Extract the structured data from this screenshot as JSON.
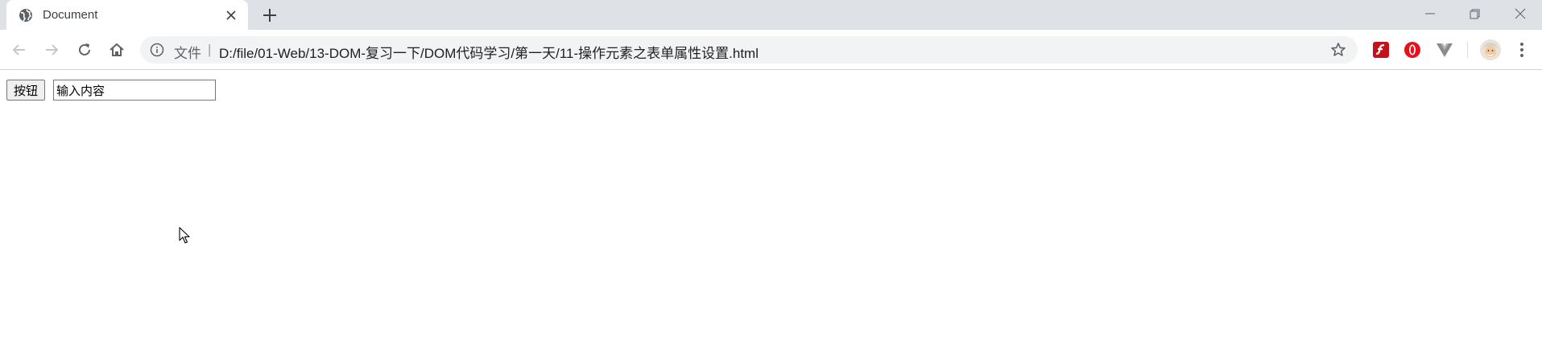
{
  "tab": {
    "title": "Document",
    "favicon": "globe-icon",
    "close": "close-icon"
  },
  "new_tab_icon": "plus-icon",
  "window_controls": [
    "minimize-icon",
    "maximize-icon",
    "close-icon"
  ],
  "toolbar": {
    "back_icon": "arrow-left-icon",
    "forward_icon": "arrow-right-icon",
    "reload_icon": "reload-icon",
    "home_icon": "home-icon"
  },
  "address_bar": {
    "info_icon": "info-icon",
    "scheme_chip": "文件",
    "separator": "|",
    "url": "D:/file/01-Web/13-DOM-复习一下/DOM代码学习/第一天/11-操作元素之表单属性设置.html",
    "bookmark_icon": "star-icon"
  },
  "extensions": [
    "flash-icon",
    "opera-icon",
    "vue-icon"
  ],
  "profile_icon": "avatar",
  "menu_icon": "kebab-menu-icon",
  "page": {
    "button_label": "按钮",
    "input_value": "输入内容"
  },
  "colors": {
    "tabstrip": "#dee1e6",
    "omnibox": "#f1f3f4",
    "flash": "#c4111b",
    "opera": "#e8101a",
    "vue": "#8a8a8a"
  }
}
